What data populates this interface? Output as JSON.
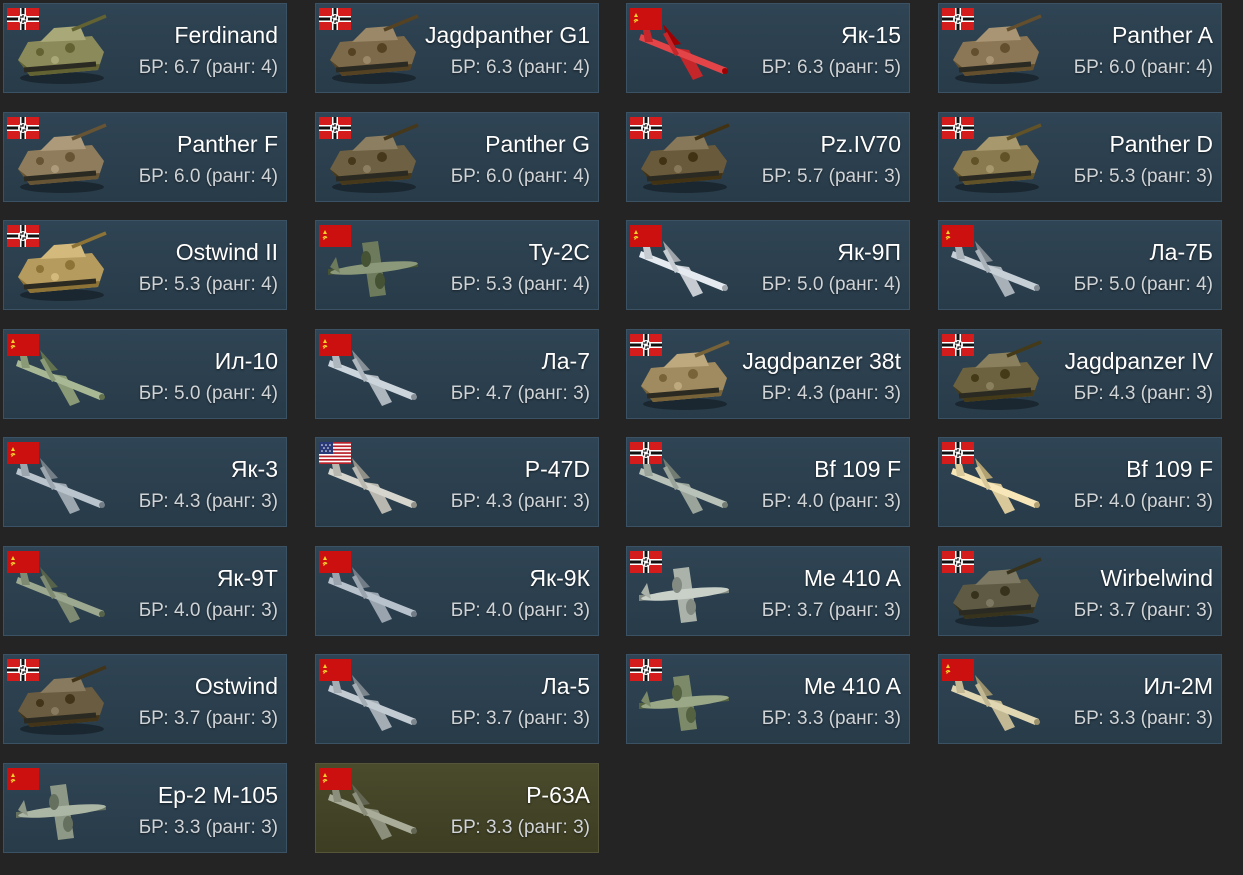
{
  "rank_label": "ранг",
  "br_label": "БР",
  "colors": {
    "background": "#242424",
    "card": "#2f4454",
    "card_highlight": "#4a4a2c",
    "text": "#ffffff",
    "subtext": "#cfd3d6"
  },
  "vehicles": [
    {
      "name": "Ferdinand",
      "br": "6.7",
      "rank": "4",
      "nation": "germany",
      "kind": "tank",
      "camo": "#8a8a5a",
      "highlight": false
    },
    {
      "name": "Jagdpanther G1",
      "br": "6.3",
      "rank": "4",
      "nation": "germany",
      "kind": "tank",
      "camo": "#7d6a4a",
      "highlight": false
    },
    {
      "name": "Як-15",
      "br": "6.3",
      "rank": "5",
      "nation": "ussr",
      "kind": "plane",
      "camo": "#c4262a",
      "highlight": false
    },
    {
      "name": "Panther A",
      "br": "6.0",
      "rank": "4",
      "nation": "germany",
      "kind": "tank",
      "camo": "#8b7755",
      "highlight": false
    },
    {
      "name": "Panther F",
      "br": "6.0",
      "rank": "4",
      "nation": "germany",
      "kind": "tank",
      "camo": "#8e7c5c",
      "highlight": false
    },
    {
      "name": "Panther G",
      "br": "6.0",
      "rank": "4",
      "nation": "germany",
      "kind": "tank",
      "camo": "#6e6042",
      "highlight": false
    },
    {
      "name": "Pz.IV70",
      "br": "5.7",
      "rank": "3",
      "nation": "germany",
      "kind": "tank",
      "camo": "#6a5a3c",
      "highlight": false
    },
    {
      "name": "Panther D",
      "br": "5.3",
      "rank": "3",
      "nation": "germany",
      "kind": "tank",
      "camo": "#8a7a50",
      "highlight": false
    },
    {
      "name": "Ostwind II",
      "br": "5.3",
      "rank": "4",
      "nation": "germany",
      "kind": "tank",
      "camo": "#b59b5e",
      "highlight": false
    },
    {
      "name": "Ту-2С",
      "br": "5.3",
      "rank": "4",
      "nation": "ussr",
      "kind": "bomber",
      "camo": "#6d7a5c",
      "highlight": false
    },
    {
      "name": "Як-9П",
      "br": "5.0",
      "rank": "4",
      "nation": "ussr",
      "kind": "plane",
      "camo": "#c6ccd2",
      "highlight": false
    },
    {
      "name": "Ла-7Б",
      "br": "5.0",
      "rank": "4",
      "nation": "ussr",
      "kind": "plane",
      "camo": "#a8b0b8",
      "highlight": false
    },
    {
      "name": "Ил-10",
      "br": "5.0",
      "rank": "4",
      "nation": "ussr",
      "kind": "plane",
      "camo": "#8a9a76",
      "highlight": false
    },
    {
      "name": "Ла-7",
      "br": "4.7",
      "rank": "3",
      "nation": "ussr",
      "kind": "plane",
      "camo": "#aeb6be",
      "highlight": false
    },
    {
      "name": "Jagdpanzer 38t",
      "br": "4.3",
      "rank": "3",
      "nation": "germany",
      "kind": "tank",
      "camo": "#a08a60",
      "highlight": false
    },
    {
      "name": "Jagdpanzer IV",
      "br": "4.3",
      "rank": "3",
      "nation": "germany",
      "kind": "tank",
      "camo": "#6c6240",
      "highlight": false
    },
    {
      "name": "Як-3",
      "br": "4.3",
      "rank": "3",
      "nation": "ussr",
      "kind": "plane",
      "camo": "#9ca6ae",
      "highlight": false
    },
    {
      "name": "P-47D",
      "br": "4.3",
      "rank": "3",
      "nation": "usa",
      "kind": "plane",
      "camo": "#b8b8b0",
      "highlight": false
    },
    {
      "name": "Bf 109 F",
      "br": "4.0",
      "rank": "3",
      "nation": "germany",
      "kind": "plane",
      "camo": "#9aa49a",
      "highlight": false
    },
    {
      "name": "Bf 109 F",
      "br": "4.0",
      "rank": "3",
      "nation": "germany",
      "kind": "plane",
      "camo": "#d8c89a",
      "highlight": false
    },
    {
      "name": "Як-9Т",
      "br": "4.0",
      "rank": "3",
      "nation": "ussr",
      "kind": "plane",
      "camo": "#7e8a72",
      "highlight": false
    },
    {
      "name": "Як-9К",
      "br": "4.0",
      "rank": "3",
      "nation": "ussr",
      "kind": "plane",
      "camo": "#9aa4ae",
      "highlight": false
    },
    {
      "name": "Me 410 A",
      "br": "3.7",
      "rank": "3",
      "nation": "germany",
      "kind": "bomber",
      "camo": "#aab2aa",
      "highlight": false
    },
    {
      "name": "Wirbelwind",
      "br": "3.7",
      "rank": "3",
      "nation": "germany",
      "kind": "tank",
      "camo": "#5e5a44",
      "highlight": false
    },
    {
      "name": "Ostwind",
      "br": "3.7",
      "rank": "3",
      "nation": "germany",
      "kind": "tank",
      "camo": "#6a5c40",
      "highlight": false
    },
    {
      "name": "Ла-5",
      "br": "3.7",
      "rank": "3",
      "nation": "ussr",
      "kind": "plane",
      "camo": "#a4acb4",
      "highlight": false
    },
    {
      "name": "Me 410 A",
      "br": "3.3",
      "rank": "3",
      "nation": "germany",
      "kind": "bomber",
      "camo": "#7c8a6a",
      "highlight": false
    },
    {
      "name": "Ил-2М",
      "br": "3.3",
      "rank": "3",
      "nation": "ussr",
      "kind": "plane",
      "camo": "#c2b894",
      "highlight": false
    },
    {
      "name": "Ер-2 М-105",
      "br": "3.3",
      "rank": "3",
      "nation": "ussr",
      "kind": "bomber",
      "camo": "#8e9886",
      "highlight": false
    },
    {
      "name": "P-63A",
      "br": "3.3",
      "rank": "3",
      "nation": "ussr",
      "kind": "plane",
      "camo": "#8a8e7a",
      "highlight": true
    }
  ]
}
